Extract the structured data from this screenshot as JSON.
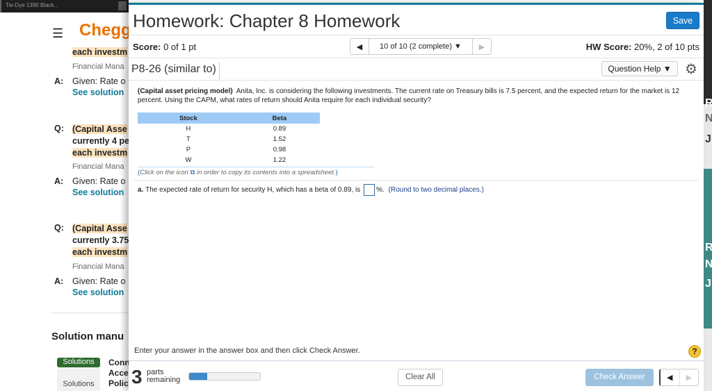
{
  "browser": {
    "tab_title": "Tie-Dye 1390 Black..."
  },
  "background_page": {
    "logo": "Chegg",
    "items": [
      {
        "question": "each investm",
        "source": "Financial Mana",
        "answer": "Given: Rate o",
        "link": "See solution"
      },
      {
        "question_lines": [
          "(Capital Asse",
          "currently 4 pe",
          "each investm"
        ],
        "source": "Financial Mana",
        "answer": "Given: Rate o",
        "link": "See solution"
      },
      {
        "question_lines": [
          "(Capital Asse",
          "currently 3.75",
          "each investm"
        ],
        "source": "Financial Mana",
        "answer": "Given: Rate o",
        "link": "See solution"
      }
    ],
    "q_label": "Q:",
    "a_label": "A:",
    "solution_manuals": "Solution manu",
    "tabs": [
      "Solutions",
      "Solutions"
    ],
    "side_text": [
      "Conn",
      "Acce",
      "Polic"
    ],
    "right_letters": [
      "R",
      "N",
      "J",
      "R",
      "N",
      "J"
    ]
  },
  "modal": {
    "title": "Homework: Chapter 8 Homework",
    "save": "Save",
    "score_label": "Score:",
    "score_value": "0 of 1 pt",
    "pager": "10 of 10 (2 complete)",
    "hw_label": "HW Score:",
    "hw_value": "20%, 2 of 10 pts",
    "problem_id": "P8-26 (similar to)",
    "question_help": "Question Help",
    "question_bold": "(Capital asset pricing model)",
    "question_text": "Anita, Inc. is considering the following investments.  The current rate on Treasury bills is 7.5 percent, and the expected return for the market is 12 percent.  Using the CAPM, what rates of return should Anita require for each individual security?",
    "table": {
      "headers": [
        "Stock",
        "Beta"
      ],
      "rows": [
        [
          "H",
          "0.89"
        ],
        [
          "T",
          "1.52"
        ],
        [
          "P",
          "0.98"
        ],
        [
          "W",
          "1.22"
        ]
      ]
    },
    "note_pre": "Click on the icon",
    "note_post": "in order to copy its contents into a spreadsheet.",
    "part_a_label": "a.",
    "part_a_text": "The expected rate of return for security H, which has a beta of 0.89, is",
    "part_a_unit": "%.",
    "part_a_round": "(Round to two decimal places.)",
    "instructions": "Enter your answer in the answer box and then click Check Answer.",
    "parts_count": "3",
    "parts_text1": "parts",
    "parts_text2": "remaining",
    "progress_percent": 25,
    "clear_all": "Clear All",
    "check_answer": "Check Answer"
  }
}
